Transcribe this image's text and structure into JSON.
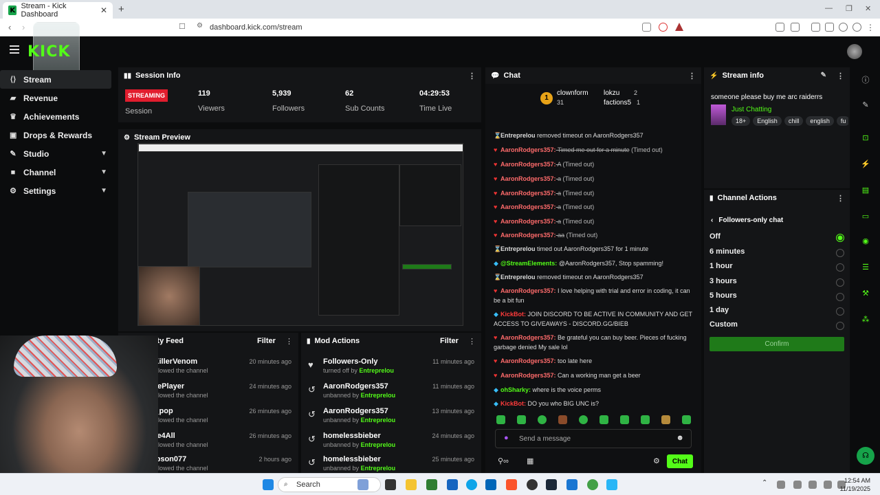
{
  "browser": {
    "tab_title": "Stream - Kick Dashboard",
    "tab_favicon": "K",
    "url": "dashboard.kick.com/stream"
  },
  "app": {
    "logo": "KICK"
  },
  "sidebar": {
    "items": [
      {
        "label": "Stream",
        "icon": "stream-icon"
      },
      {
        "label": "Revenue",
        "icon": "revenue-icon"
      },
      {
        "label": "Achievements",
        "icon": "trophy-icon"
      },
      {
        "label": "Drops & Rewards",
        "icon": "gift-icon"
      },
      {
        "label": "Studio",
        "icon": "studio-icon"
      },
      {
        "label": "Channel",
        "icon": "channel-icon"
      },
      {
        "label": "Settings",
        "icon": "gear-icon"
      }
    ]
  },
  "session": {
    "title": "Session Info",
    "badge": "STREAMING",
    "badge_label": "Session",
    "stats": [
      {
        "value": "119",
        "label": "Viewers"
      },
      {
        "value": "5,939",
        "label": "Followers"
      },
      {
        "value": "62",
        "label": "Sub Counts"
      },
      {
        "value": "04:29:53",
        "label": "Time Live"
      }
    ]
  },
  "preview": {
    "title": "Stream Preview"
  },
  "activity": {
    "title": "Activity Feed",
    "filter": "Filter",
    "items": [
      {
        "name": "TheKillerVenom",
        "sub": "just followed the channel",
        "time": "20 minutes ago"
      },
      {
        "name": "MainePlayer",
        "sub": "just followed the channel",
        "time": "24 minutes ago"
      },
      {
        "name": "ville_pop",
        "sub": "just followed the channel",
        "time": "26 minutes ago"
      },
      {
        "name": "Stone4All",
        "sub": "just followed the channel",
        "time": "26 minutes ago"
      },
      {
        "name": "tsimpson077",
        "sub": "just followed the channel",
        "time": "2 hours ago"
      }
    ]
  },
  "mod": {
    "title": "Mod Actions",
    "filter": "Filter",
    "items": [
      {
        "name": "Followers-Only",
        "action": "turned off by",
        "by": "Entreprelou",
        "time": "11 minutes ago"
      },
      {
        "name": "AaronRodgers357",
        "action": "unbanned by",
        "by": "Entreprelou",
        "time": "11 minutes ago"
      },
      {
        "name": "AaronRodgers357",
        "action": "unbanned by",
        "by": "Entreprelou",
        "time": "13 minutes ago"
      },
      {
        "name": "homelessbieber",
        "action": "unbanned by",
        "by": "Entreprelou",
        "time": "24 minutes ago"
      },
      {
        "name": "homelessbieber",
        "action": "unbanned by",
        "by": "Entreprelou",
        "time": "25 minutes ago"
      }
    ]
  },
  "chat": {
    "title": "Chat",
    "leaderboard": {
      "rank": "1",
      "user1": "clownform",
      "user1_count": "31",
      "user2": "lokzu",
      "user2_count": "2",
      "user3": "factions5",
      "user3_count": "1"
    },
    "messages": [
      {
        "user": "Entreprelou",
        "text": "removed timeout on AaronRodgers357",
        "kind": "system"
      },
      {
        "user": "AaronRodgers357:",
        "text": "Timed me out for a minute",
        "suffix": "(Timed out)",
        "kind": "timed"
      },
      {
        "user": "AaronRodgers357:",
        "text": "A",
        "suffix": "(Timed out)",
        "kind": "timed"
      },
      {
        "user": "AaronRodgers357:",
        "text": "a",
        "suffix": "(Timed out)",
        "kind": "timed"
      },
      {
        "user": "AaronRodgers357:",
        "text": "a",
        "suffix": "(Timed out)",
        "kind": "timed"
      },
      {
        "user": "AaronRodgers357:",
        "text": "a",
        "suffix": "(Timed out)",
        "kind": "timed"
      },
      {
        "user": "AaronRodgers357:",
        "text": "a",
        "suffix": "(Timed out)",
        "kind": "timed"
      },
      {
        "user": "AaronRodgers357:",
        "text": "aa",
        "suffix": "(Timed out)",
        "kind": "timed"
      },
      {
        "user": "Entreprelou",
        "text": "timed out AaronRodgers357 for 1 minute",
        "kind": "system"
      },
      {
        "user": "@StreamElements:",
        "text": "@AaronRodgers357, Stop spamming!",
        "kind": "bot"
      },
      {
        "user": "Entreprelou",
        "text": "removed timeout on AaronRodgers357",
        "kind": "system"
      },
      {
        "user": "AaronRodgers357:",
        "text": "I love helping with trial and error in coding, it can be a bit fun",
        "kind": "msg"
      },
      {
        "user": "KickBot:",
        "text": "JOIN DISCORD TO BE ACTIVE IN COMMUNITY AND GET ACCESS TO GIVEAWAYS - DISCORD.GG/BIEB",
        "kind": "bot2"
      },
      {
        "user": "AaronRodgers357:",
        "text": "Be grateful you can buy beer. Pieces of fucking garbage denied My sale lol",
        "kind": "msg"
      },
      {
        "user": "AaronRodgers357:",
        "text": "too late here",
        "kind": "msg"
      },
      {
        "user": "AaronRodgers357:",
        "text": "Can a working man get a beer",
        "kind": "msg"
      },
      {
        "user": "ohSharky:",
        "text": "where is the voice perms",
        "kind": "bot"
      },
      {
        "user": "KickBot:",
        "text": "DO you who BIG UNC is?",
        "kind": "bot2"
      }
    ],
    "input_placeholder": "Send a message",
    "send_label": "Chat"
  },
  "stream_info": {
    "title": "Stream info",
    "stream_title": "someone please buy me arc raiderrs",
    "category": "Just Chatting",
    "tags": [
      "18+",
      "English",
      "chill",
      "english",
      "fu"
    ]
  },
  "channel_actions": {
    "title": "Channel Actions",
    "subtitle": "Followers-only chat",
    "options": [
      "Off",
      "6 minutes",
      "1 hour",
      "3 hours",
      "5 hours",
      "1 day",
      "Custom"
    ],
    "selected": "Off",
    "confirm": "Confirm"
  },
  "taskbar": {
    "search": "Search",
    "time": "12:54 AM",
    "date": "11/19/2025"
  },
  "colors": {
    "accent": "#53fc18",
    "streaming": "#e11d2e",
    "username": "#ff6b6b"
  }
}
